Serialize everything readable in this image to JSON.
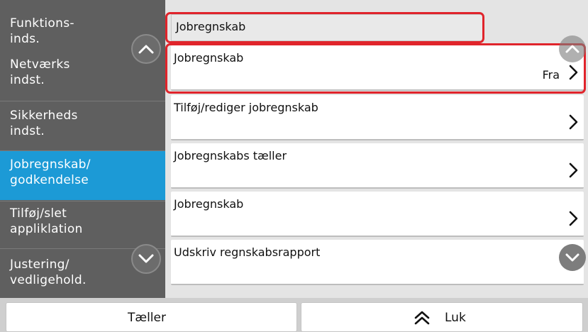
{
  "sidebar": {
    "items": [
      {
        "label": "Funktions-\ninds."
      },
      {
        "label": "Netværks\nindst."
      },
      {
        "label": "Sikkerheds\nindst."
      },
      {
        "label": "Jobregnskab/\ngodkendelse"
      },
      {
        "label": "Tilføj/slet\nappliklation"
      },
      {
        "label": "Justering/\nvedligehold."
      }
    ]
  },
  "main": {
    "header": "Jobregnskab",
    "rows": [
      {
        "label": "Jobregnskab",
        "value": "Fra"
      },
      {
        "label": "Tilføj/rediger jobregnskab",
        "value": ""
      },
      {
        "label": "Jobregnskabs tæller",
        "value": ""
      },
      {
        "label": "Jobregnskab",
        "value": ""
      },
      {
        "label": "Udskriv regnskabsrapport",
        "value": ""
      }
    ]
  },
  "bottom": {
    "left_label": "Tæller",
    "right_label": "Luk"
  },
  "colors": {
    "sidebar_bg": "#5f5f5f",
    "active_item": "#1c9ad6",
    "highlight": "#e0242b"
  },
  "icons": {
    "scroll_up": "chevron-up-icon",
    "scroll_down": "chevron-down-icon",
    "row_arrow": "chevron-right-icon",
    "close": "double-chevron-up-icon"
  }
}
